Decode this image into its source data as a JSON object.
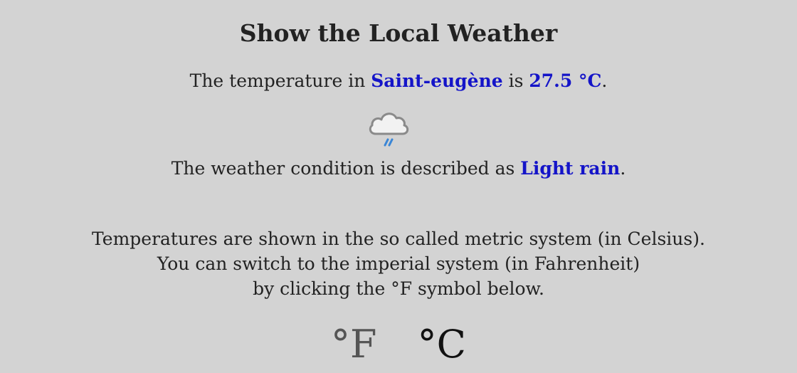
{
  "header": {
    "title": "Show the Local Weather"
  },
  "temperature": {
    "prefix": "The temperature in",
    "city": "Saint-eugène",
    "middle": "is",
    "value": "27.5 °C",
    "suffix": "."
  },
  "weather_icon": "light-rain-cloud-icon",
  "condition": {
    "prefix": "The weather condition is described as",
    "description": "Light rain",
    "suffix": "."
  },
  "info": {
    "line1": "Temperatures are shown in the so called metric system (in Celsius).",
    "line2": "You can switch to the imperial system (in Fahrenheit)",
    "line3": "by clicking the °F symbol below."
  },
  "units": {
    "fahrenheit_label": "°F",
    "celsius_label": "°C"
  },
  "colors": {
    "background": "#d3d3d3",
    "highlight": "#1414c8",
    "text": "#222222"
  }
}
